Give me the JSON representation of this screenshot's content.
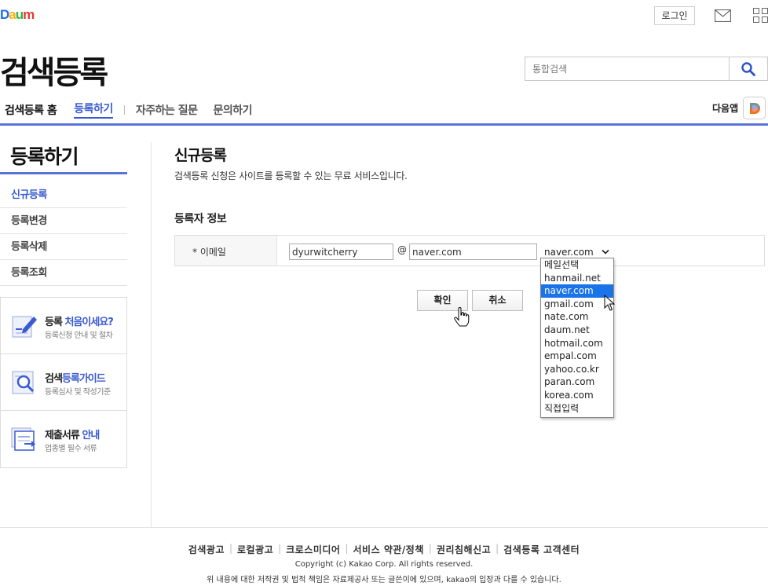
{
  "header": {
    "logo": "Daum",
    "login_label": "로그인",
    "search_placeholder": "통합검색",
    "site_title": "검색등록",
    "daum_app_label": "다음앱",
    "daum_app_badge": "D"
  },
  "gnb": {
    "home": "검색등록 홈",
    "register": "등록하기",
    "faq": "자주하는 질문",
    "contact": "문의하기"
  },
  "sidebar": {
    "title": "등록하기",
    "items": [
      {
        "label": "신규등록"
      },
      {
        "label": "등록변경"
      },
      {
        "label": "등록삭제"
      },
      {
        "label": "등록조회"
      }
    ],
    "promos": [
      {
        "title_a": "등록 ",
        "title_hl": "처음이세요?",
        "sub": "등록신청 안내 및 절차"
      },
      {
        "title_a": "검색",
        "title_hl": "등록가이드",
        "sub": "등록심사 및 작성기준"
      },
      {
        "title_a": "제출서류 ",
        "title_hl": "안내",
        "sub": "업종별 필수 서류"
      }
    ]
  },
  "main": {
    "title": "신규등록",
    "desc": "검색등록 신청은 사이트를 등록할 수 있는 무료 서비스입니다.",
    "section_title": "등록자 정보",
    "email_label": "* 이메일",
    "email_local": "dyurwitcherry",
    "at": "@",
    "email_domain": "naver.com",
    "domain_selected": "naver.com",
    "domain_options": [
      "메일선택",
      "hanmail.net",
      "naver.com",
      "gmail.com",
      "nate.com",
      "daum.net",
      "hotmail.com",
      "empal.com",
      "yahoo.co.kr",
      "paran.com",
      "korea.com",
      "직접입력"
    ],
    "ok_label": "확인",
    "cancel_label": "취소"
  },
  "footer": {
    "links": [
      "검색광고",
      "로컬광고",
      "크로스미디어",
      "서비스 약관/정책",
      "권리침해신고",
      "검색등록 고객센터"
    ],
    "copyright": "Copyright (c) Kakao Corp. All rights reserved.",
    "disclaimer": "위 내용에 대한 저작권 및 법적 책임은 자료제공사 또는 글쓴이에 있으며, kakao의 입장과 다를 수 있습니다."
  },
  "colors": {
    "accent": "#3a5bd1",
    "rule": "#5a74d6",
    "selected": "#1a73e8"
  }
}
